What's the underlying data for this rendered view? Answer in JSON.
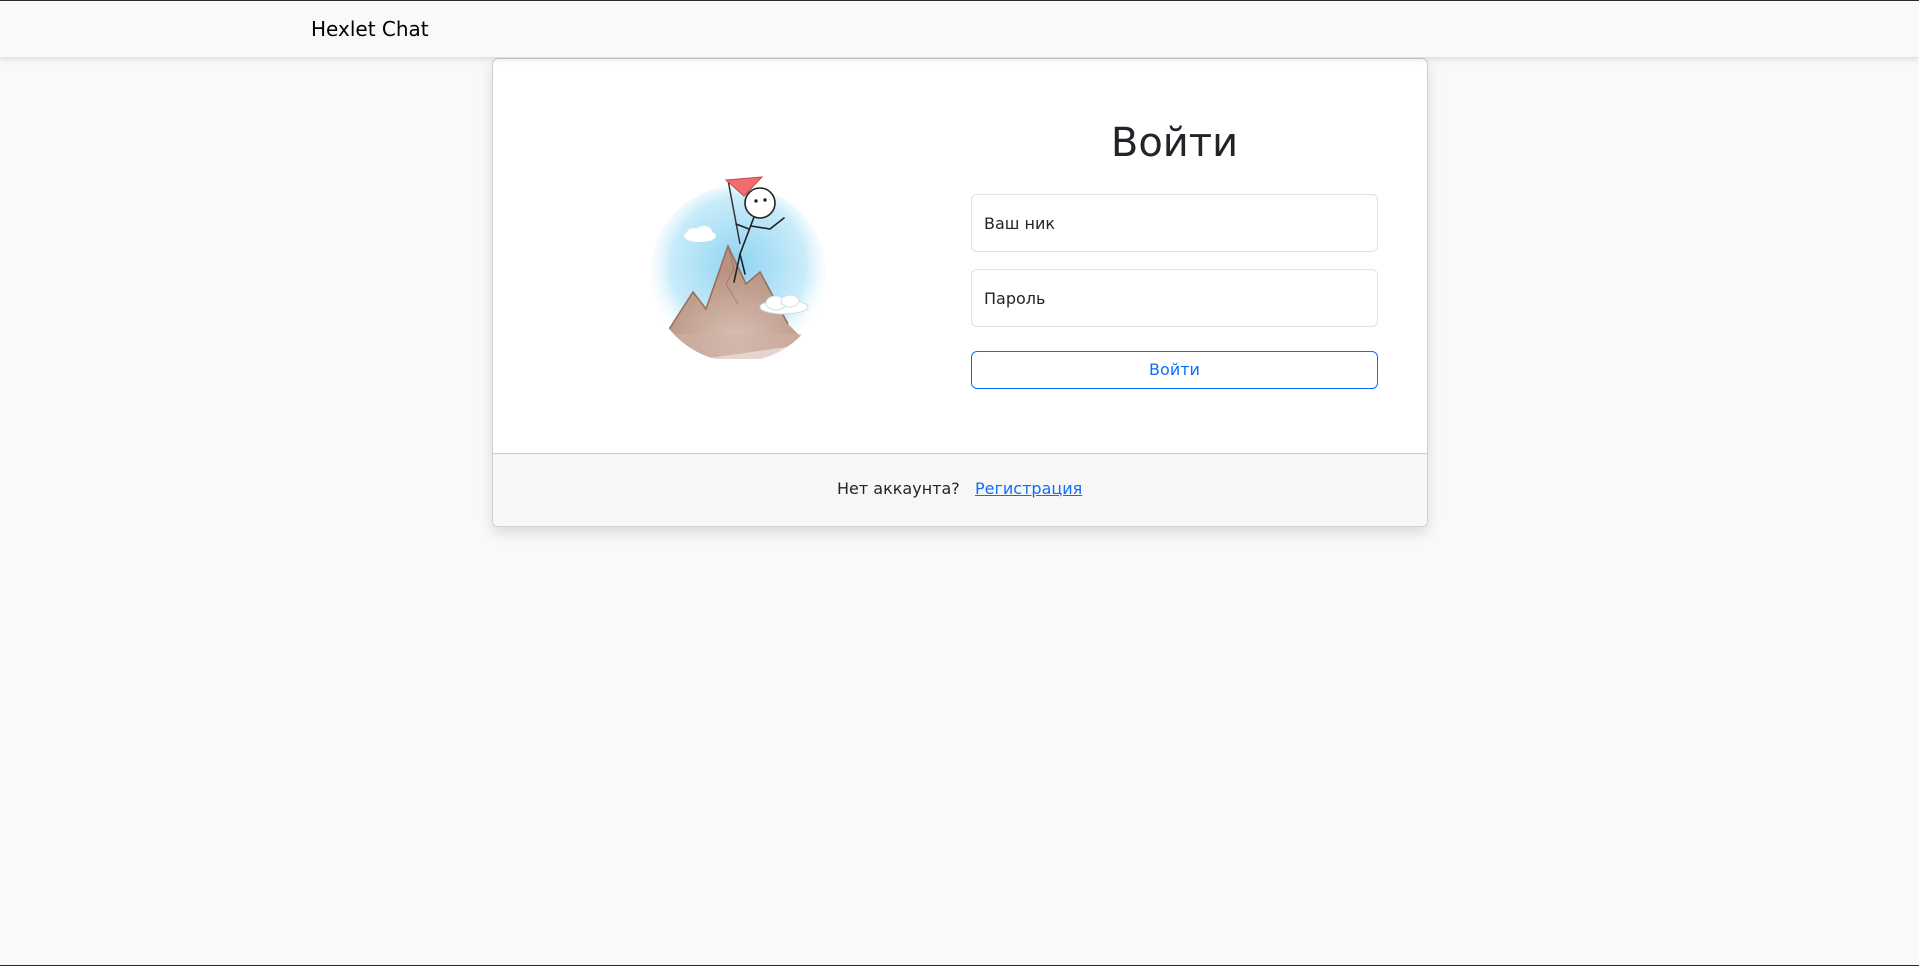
{
  "navbar": {
    "brand": "Hexlet Chat"
  },
  "login_card": {
    "illustration": "avatar-illustration",
    "title": "Войти",
    "username_placeholder": "Ваш ник",
    "password_placeholder": "Пароль",
    "submit_label": "Войти"
  },
  "footer": {
    "prompt_text": "Нет аккаунта?",
    "signup_link": "Регистрация"
  },
  "colors": {
    "page_background": "#f8f9fa",
    "accent": "#0d6efd",
    "flag": "#f26d6d"
  }
}
